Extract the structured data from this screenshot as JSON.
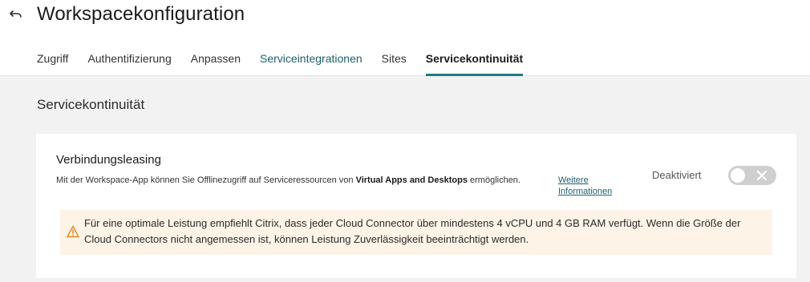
{
  "header": {
    "title": "Workspacekonfiguration",
    "back_icon": "back-arrow-icon"
  },
  "tabs": [
    {
      "label": "Zugriff",
      "state": "normal"
    },
    {
      "label": "Authentifizierung",
      "state": "normal"
    },
    {
      "label": "Anpassen",
      "state": "normal"
    },
    {
      "label": "Serviceintegrationen",
      "state": "link"
    },
    {
      "label": "Sites",
      "state": "normal"
    },
    {
      "label": "Servicekontinuität",
      "state": "active"
    }
  ],
  "section": {
    "title": "Servicekontinuität"
  },
  "card": {
    "title": "Verbindungsleasing",
    "description_prefix": "Mit der Workspace-App können Sie Offlinezugriff auf Serviceressourcen von ",
    "description_bold": "Virtual Apps and Desktops",
    "description_suffix": " ermöglichen.",
    "more_link": "Weitere Informationen",
    "status_label": "Deaktiviert",
    "toggle_enabled": false,
    "warning": "Für eine optimale Leistung empfiehlt Citrix, dass jeder Cloud Connector über mindestens 4 vCPU und 4 GB RAM verfügt. Wenn die Größe der Cloud Connectors nicht angemessen ist, können Leistung Zuverlässigkeit beeinträchtigt werden.",
    "warning_icon": "warning-triangle-icon"
  },
  "colors": {
    "accent": "#1f7a86",
    "link": "#1f5f6b",
    "warning_bg": "#fdf3e6",
    "warning_icon": "#e08a1e"
  }
}
